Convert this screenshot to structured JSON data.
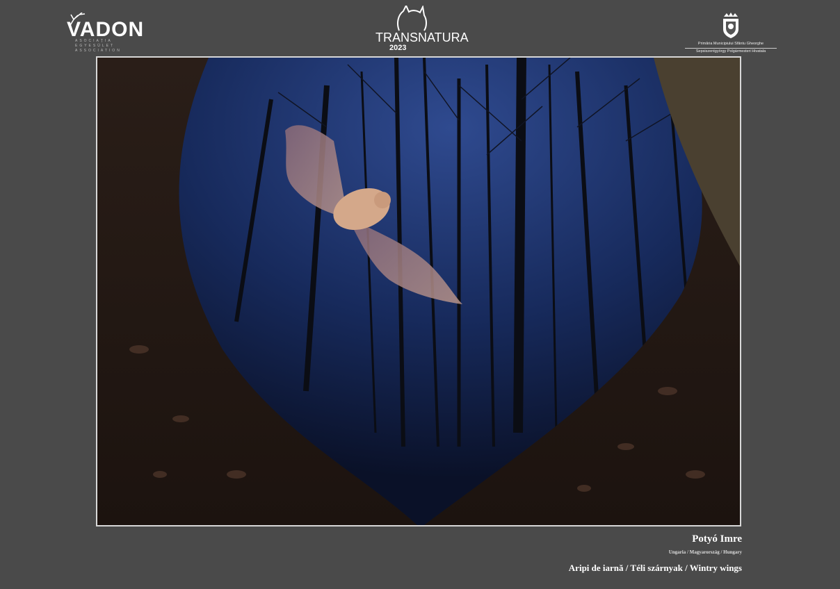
{
  "logos": {
    "vadon": {
      "name": "VADON",
      "sub": [
        "ASOCIAȚIA",
        "EGYESÜLET",
        "ASSOCIATION"
      ]
    },
    "transnatura": {
      "word": "TRANSNATURA",
      "year": "2023"
    },
    "primaria": {
      "line1": "Primăria Municipiului Sfântu Gheorghe",
      "line2": "Sepsiszentgyörgy Polgármesteri Hivatala"
    }
  },
  "photo": {
    "subject": "bat-in-flight-night-forest",
    "colors": {
      "sky": "#1a2e66",
      "ground": "#3a2a20",
      "bat": "#c99a7c"
    }
  },
  "caption": {
    "author": "Potyó Imre",
    "country": "Ungaria / Magyarország / Hungary",
    "title": "Aripi de iarnă / Téli szárnyak / Wintry wings"
  }
}
